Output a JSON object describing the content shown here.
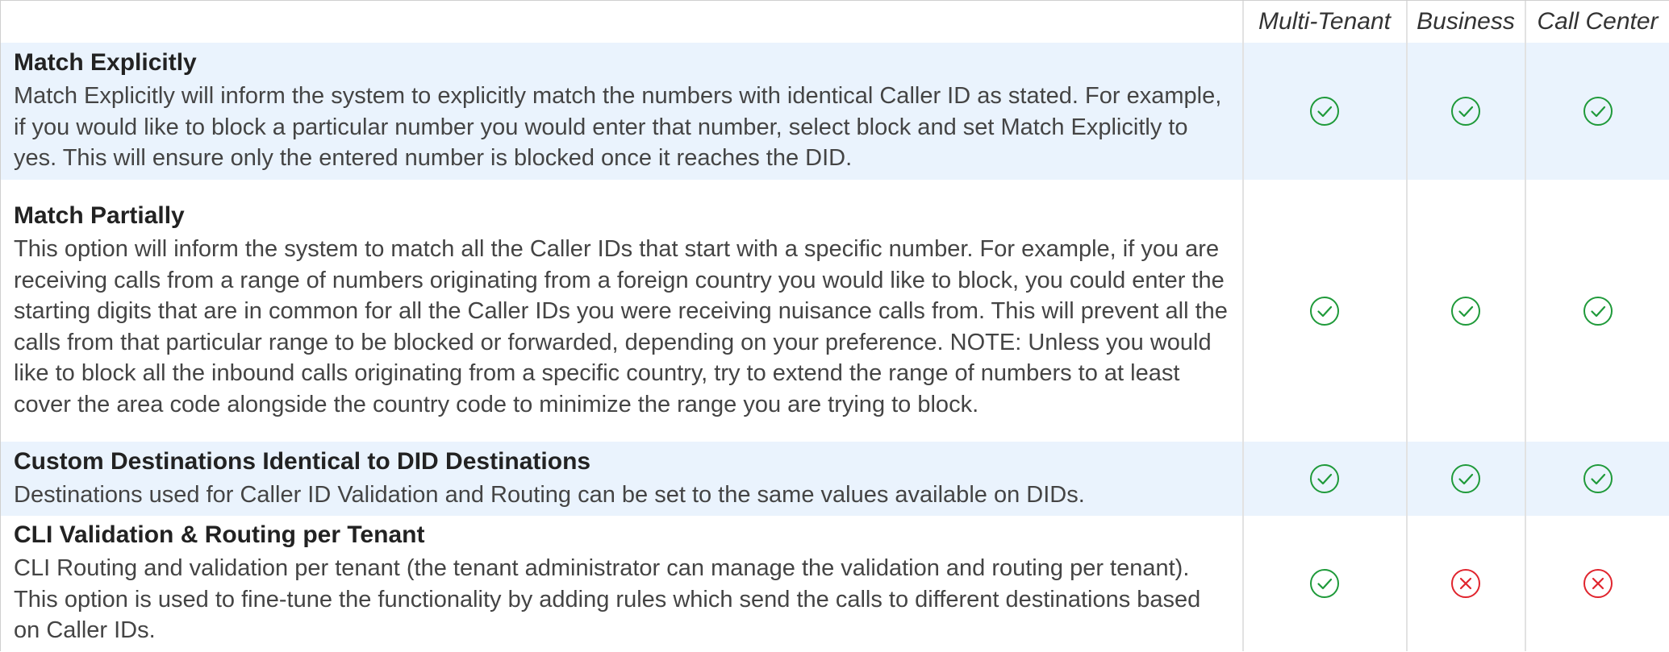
{
  "columns": [
    "Multi-Tenant",
    "Business",
    "Call Center"
  ],
  "rows": [
    {
      "title": "Match Explicitly",
      "description": "Match Explicitly will inform the system to explicitly match the numbers with identical Caller ID as stated. For example, if you would like to block a particular number you would enter that number, select block and set Match Explicitly to yes. This will ensure only the entered number is blocked once it reaches the DID.",
      "support": [
        "check-circle-icon",
        "check-circle-icon",
        "check-circle-icon"
      ]
    },
    {
      "title": "Match Partially",
      "description": "This option will inform the system to match all the Caller IDs that start with a specific number. For example, if you are receiving calls from a range of numbers originating from a foreign country you would like to block, you could enter the starting digits that are in common for all the Caller IDs you were receiving nuisance calls from. This will prevent all the calls from that particular range to be blocked or forwarded, depending on your preference. NOTE: Unless you would like to block all the inbound calls originating from a specific country, try to extend the range of numbers to at least cover the area code alongside the country code to minimize the range you are trying to block.",
      "support": [
        "check-circle-icon",
        "check-circle-icon",
        "check-circle-icon"
      ]
    },
    {
      "title": "Custom Destinations Identical to DID Destinations",
      "description": "Destinations used for Caller ID Validation and Routing can be set to the same values available on DIDs.",
      "support": [
        "check-circle-icon",
        "check-circle-icon",
        "check-circle-icon"
      ]
    },
    {
      "title": "CLI Validation & Routing per Tenant",
      "description": "CLI Routing and validation per tenant (the tenant administrator can manage the validation and routing per tenant). This option is used to fine-tune the functionality by adding rules which send the calls to different destinations based on Caller IDs.",
      "support": [
        "check-circle-icon",
        "x-circle-icon",
        "x-circle-icon"
      ]
    }
  ],
  "colors": {
    "check": "#1f9a3a",
    "cross": "#e0242d",
    "row_highlight": "#eaf3fd"
  }
}
